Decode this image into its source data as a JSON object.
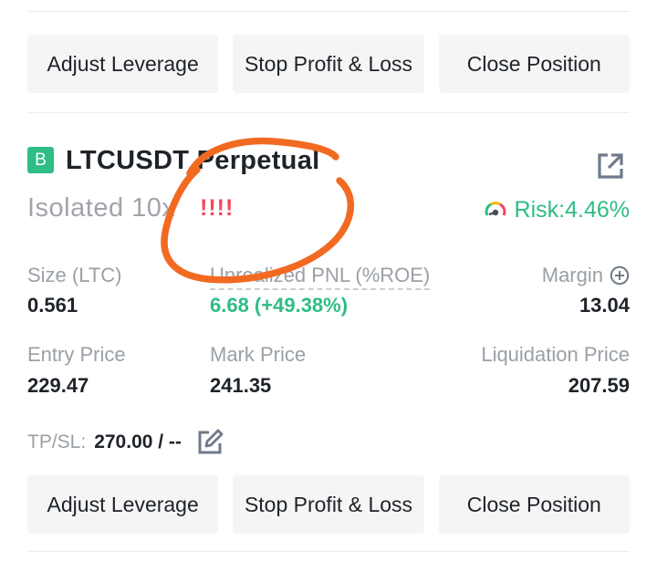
{
  "top_actions": {
    "adjust_leverage": "Adjust Leverage",
    "stop_profit_loss": "Stop Profit & Loss",
    "close_position": "Close Position"
  },
  "position": {
    "side_badge": "B",
    "symbol": "LTCUSDT Perpetual",
    "share_icon": "share-external-icon",
    "margin_mode": "Isolated 10x",
    "warning_marks": "!!!!",
    "risk_label": "Risk:4.46%",
    "fields": {
      "size_label": "Size (LTC)",
      "size_value": "0.561",
      "pnl_label": "Unrealized PNL (%ROE)",
      "pnl_value": "6.68 (+49.38%)",
      "margin_label": "Margin",
      "margin_value": "13.04",
      "entry_label": "Entry Price",
      "entry_value": "229.47",
      "mark_label": "Mark Price",
      "mark_value": "241.35",
      "liq_label": "Liquidation Price",
      "liq_value": "207.59"
    },
    "tpsl_label": "TP/SL:",
    "tpsl_value": "270.00 / --"
  },
  "bottom_actions": {
    "adjust_leverage": "Adjust Leverage",
    "stop_profit_loss": "Stop Profit & Loss",
    "close_position": "Close Position"
  },
  "colors": {
    "profit_green": "#2ebd85",
    "loss_red": "#f6465d",
    "annotation_orange": "#f26a21"
  }
}
